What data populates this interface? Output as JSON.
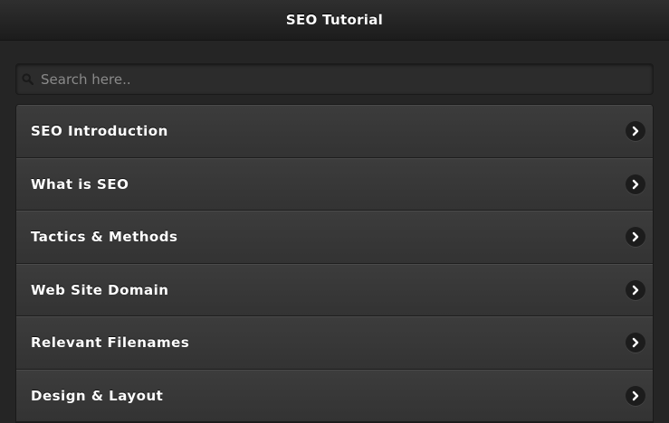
{
  "header": {
    "title": "SEO Tutorial"
  },
  "search": {
    "placeholder": "Search here..",
    "value": "",
    "icon": "search-icon"
  },
  "menu": {
    "items": [
      {
        "label": "SEO Introduction",
        "icon": "chevron-right-icon"
      },
      {
        "label": "What is SEO",
        "icon": "chevron-right-icon"
      },
      {
        "label": "Tactics & Methods",
        "icon": "chevron-right-icon"
      },
      {
        "label": "Web Site Domain",
        "icon": "chevron-right-icon"
      },
      {
        "label": "Relevant Filenames",
        "icon": "chevron-right-icon"
      },
      {
        "label": "Design & Layout",
        "icon": "chevron-right-icon"
      }
    ]
  },
  "colors": {
    "background": "#252525",
    "header": "#232323",
    "list_item": "#383838",
    "text": "#ffffff",
    "placeholder": "#8a8a8a"
  }
}
